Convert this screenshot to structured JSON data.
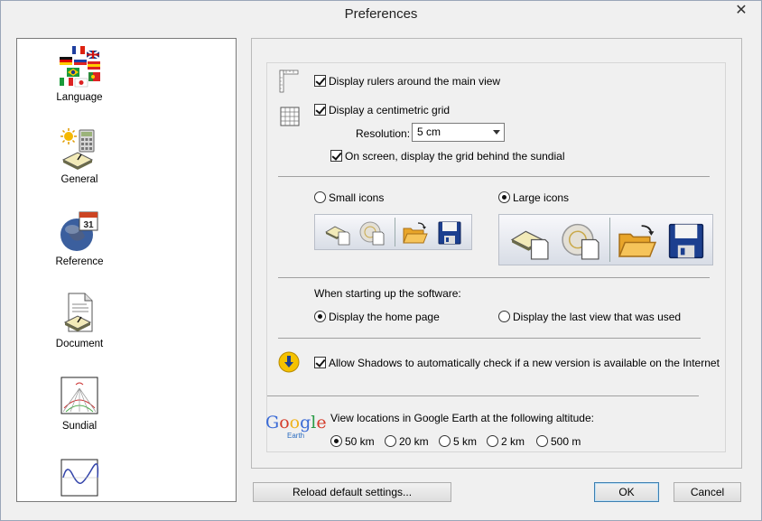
{
  "window": {
    "title": "Preferences",
    "close_glyph": "✕"
  },
  "sidebar": {
    "items": [
      {
        "label": "Language",
        "icon": "flags-icon"
      },
      {
        "label": "General",
        "icon": "general-icon"
      },
      {
        "label": "Reference",
        "icon": "globe-calendar-icon"
      },
      {
        "label": "Document",
        "icon": "document-icon"
      },
      {
        "label": "Sundial",
        "icon": "sundial-icon"
      },
      {
        "label": "",
        "icon": "curve-icon"
      }
    ]
  },
  "rulers": {
    "label": "Display rulers around the main view",
    "checked": true
  },
  "grid": {
    "label": "Display a centimetric grid",
    "checked": true,
    "resolution_label": "Resolution:",
    "resolution_value": "5 cm",
    "behind_label": "On screen, display the grid behind the sundial",
    "behind_checked": true
  },
  "icons": {
    "small_label": "Small icons",
    "small_selected": false,
    "large_label": "Large icons",
    "large_selected": true
  },
  "startup": {
    "label": "When starting up the software:",
    "home_label": "Display the home page",
    "home_selected": true,
    "last_label": "Display the last view that was used",
    "last_selected": false
  },
  "update": {
    "label": "Allow Shadows to automatically check if a new version is available on the Internet",
    "checked": true
  },
  "google": {
    "logo_text": "Google",
    "logo_sub": "Earth",
    "label": "View locations in Google Earth at the following altitude:",
    "options": [
      "50 km",
      "20 km",
      "5 km",
      "2 km",
      "500 m"
    ],
    "selected": "50 km"
  },
  "buttons": {
    "reload": "Reload default settings...",
    "ok": "OK",
    "cancel": "Cancel"
  }
}
